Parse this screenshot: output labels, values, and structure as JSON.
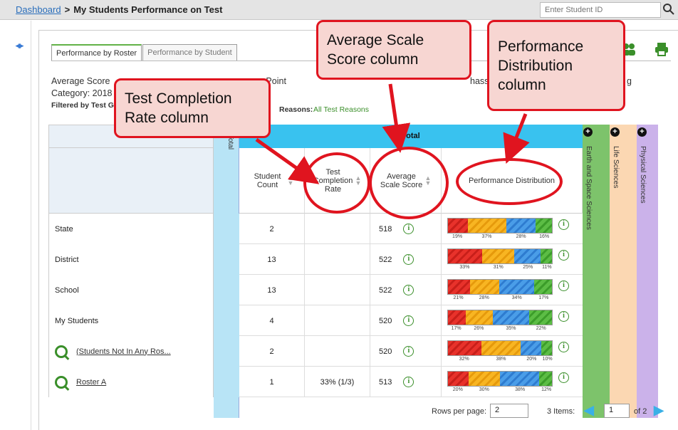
{
  "breadcrumb": {
    "home": "Dashboard",
    "separator": ">",
    "current": "My Students Performance on Test"
  },
  "search": {
    "placeholder": "Enter Student ID"
  },
  "tabs": [
    {
      "label": "Performance by Roster",
      "active": true
    },
    {
      "label": "Performance by Student",
      "active": false
    }
  ],
  "report": {
    "line1_start": "Average Score",
    "line1_mid": "e Point",
    "line1_end": "hass",
    "line1_tail": "g",
    "line2": "Category: 2018",
    "filter_label": "Filtered by Test G",
    "reasons_label": "Reasons:",
    "reasons_value": "All Test Reasons"
  },
  "table": {
    "total_header": "Total",
    "total_vertical": "Total",
    "columns": {
      "student_count": "Student Count",
      "completion": "Test Completion Rate",
      "avg_score": "Average Scale Score",
      "distribution": "Performance Distribution"
    },
    "rows": [
      {
        "label": "State",
        "link": false,
        "count": "2",
        "completion": "",
        "score": "518",
        "dist": [
          19,
          37,
          28,
          16
        ],
        "labels": [
          "19%",
          "37%",
          "28%",
          "16%"
        ]
      },
      {
        "label": "District",
        "link": false,
        "count": "13",
        "completion": "",
        "score": "522",
        "dist": [
          33,
          31,
          25,
          11
        ],
        "labels": [
          "33%",
          "31%",
          "25%",
          "11%"
        ]
      },
      {
        "label": "School",
        "link": false,
        "count": "13",
        "completion": "",
        "score": "522",
        "dist": [
          21,
          28,
          34,
          17
        ],
        "labels": [
          "21%",
          "28%",
          "34%",
          "17%"
        ]
      },
      {
        "label": "My Students",
        "link": false,
        "count": "4",
        "completion": "",
        "score": "520",
        "dist": [
          17,
          26,
          35,
          22
        ],
        "labels": [
          "17%",
          "26%",
          "35%",
          "22%"
        ]
      },
      {
        "label": "(Students Not In Any Ros...",
        "link": true,
        "count": "2",
        "completion": "",
        "score": "520",
        "dist": [
          32,
          38,
          20,
          10
        ],
        "labels": [
          "32%",
          "38%",
          "20%",
          "10%"
        ]
      },
      {
        "label": "Roster A",
        "link": true,
        "count": "1",
        "completion": "33% (1/3)",
        "score": "513",
        "dist": [
          20,
          30,
          38,
          12
        ],
        "labels": [
          "20%",
          "30%",
          "38%",
          "12%"
        ]
      }
    ]
  },
  "side_columns": [
    {
      "label": "Earth and Space Sciences",
      "color": "#7dc36b"
    },
    {
      "label": "Life Sciences",
      "color": "#fbd7b2"
    },
    {
      "label": "Physical Sciences",
      "color": "#cbb2ea"
    }
  ],
  "pagination": {
    "rows_per_page_label": "Rows per page:",
    "rows_per_page": "2",
    "items": "3 Items:",
    "page": "1",
    "of_pages": "of 2"
  },
  "callouts": {
    "completion": "Test Completion Rate column",
    "completion_l1": "Test Completion",
    "completion_l2": "Rate column",
    "avg_l1": "Average Scale",
    "avg_l2": "Score column",
    "dist_l1": "Performance",
    "dist_l2": "Distribution",
    "dist_l3": "column"
  },
  "colors": {
    "accent_blue": "#39c2ef",
    "annotation_red": "#e0141f",
    "green": "#3a8f2a"
  }
}
